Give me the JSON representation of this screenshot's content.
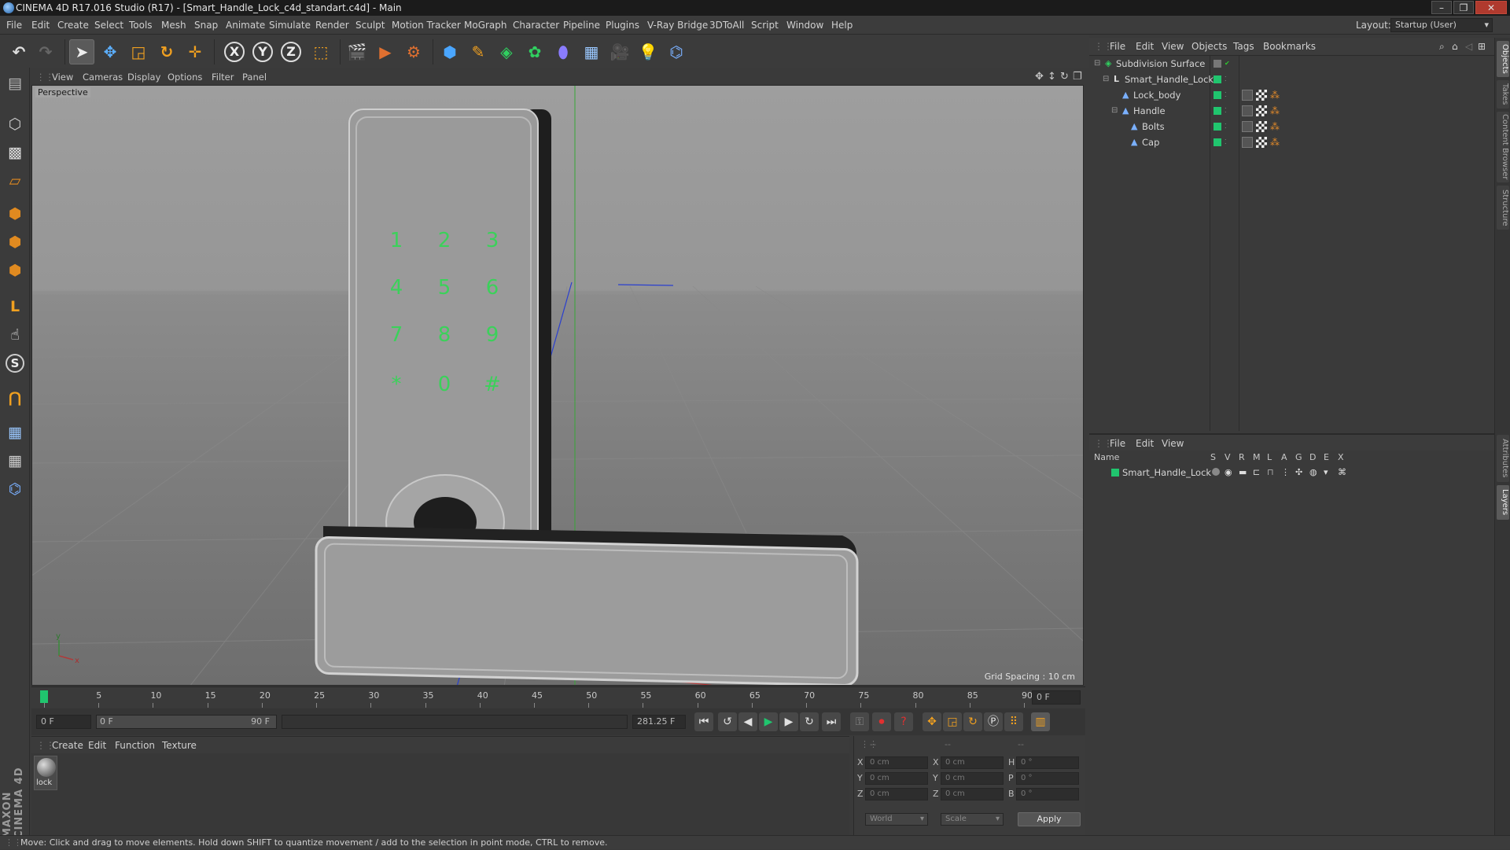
{
  "window": {
    "title": "CINEMA 4D R17.016 Studio (R17) - [Smart_Handle_Lock_c4d_standart.c4d] - Main",
    "controls": [
      "–",
      "❐",
      "✕"
    ]
  },
  "menu": [
    "File",
    "Edit",
    "Create",
    "Select",
    "Tools",
    "Mesh",
    "Snap",
    "Animate",
    "Simulate",
    "Render",
    "Sculpt",
    "Motion Tracker",
    "MoGraph",
    "Character",
    "Pipeline",
    "Plugins",
    "V-Ray Bridge",
    "3DToAll",
    "Script",
    "Window",
    "Help"
  ],
  "layout": {
    "label": "Layout:",
    "value": "Startup (User)"
  },
  "toolbar": {
    "axis_x": "X",
    "axis_y": "Y",
    "axis_z": "Z"
  },
  "viewport": {
    "menu": [
      "View",
      "Cameras",
      "Display",
      "Options",
      "Filter",
      "Panel"
    ],
    "label": "Perspective",
    "grid_spacing": "Grid Spacing : 10 cm",
    "keypad": [
      "1",
      "2",
      "3",
      "4",
      "5",
      "6",
      "7",
      "8",
      "9",
      "*",
      "0",
      "#"
    ],
    "axis_y": "y",
    "axis_x": "x"
  },
  "timeline": {
    "ticks": [
      "0",
      "5",
      "10",
      "15",
      "20",
      "25",
      "30",
      "35",
      "40",
      "45",
      "50",
      "55",
      "60",
      "65",
      "70",
      "75",
      "80",
      "85",
      "90"
    ],
    "current_frame": "0 F",
    "start_field": "0 F",
    "range_start": "0 F",
    "range_end": "90 F",
    "fps_field": "281.25 F",
    "end_field": "0 F",
    "playhead_fraction": 0
  },
  "material": {
    "menu": [
      "Create",
      "Edit",
      "Function",
      "Texture"
    ],
    "items": [
      {
        "name": "lock"
      }
    ]
  },
  "coordinates": {
    "header": [
      "--",
      "--",
      "--"
    ],
    "rows": [
      {
        "a": "X",
        "av": "0 cm",
        "b": "X",
        "bv": "0 cm",
        "c": "H",
        "cv": "0 °"
      },
      {
        "a": "Y",
        "av": "0 cm",
        "b": "Y",
        "bv": "0 cm",
        "c": "P",
        "cv": "0 °"
      },
      {
        "a": "Z",
        "av": "0 cm",
        "b": "Z",
        "bv": "0 cm",
        "c": "B",
        "cv": "0 °"
      }
    ],
    "mode": "World",
    "scale": "Scale",
    "apply": "Apply"
  },
  "objects": {
    "menu": [
      "File",
      "Edit",
      "View",
      "Objects",
      "Tags",
      "Bookmarks"
    ],
    "tree": [
      {
        "name": "Subdivision Surface",
        "depth": 0,
        "icon": "subdivision-icon"
      },
      {
        "name": "Smart_Handle_Lock",
        "depth": 1,
        "icon": "null-icon"
      },
      {
        "name": "Lock_body",
        "depth": 2,
        "icon": "polygon-icon"
      },
      {
        "name": "Handle",
        "depth": 2,
        "icon": "polygon-icon"
      },
      {
        "name": "Bolts",
        "depth": 3,
        "icon": "polygon-icon"
      },
      {
        "name": "Cap",
        "depth": 3,
        "icon": "polygon-icon"
      }
    ]
  },
  "layers": {
    "menu": [
      "File",
      "Edit",
      "View"
    ],
    "columns": [
      "Name",
      "S",
      "V",
      "R",
      "M",
      "L",
      "A",
      "G",
      "D",
      "E",
      "X"
    ],
    "rows": [
      {
        "name": "Smart_Handle_Lock"
      }
    ]
  },
  "side_tabs": [
    "Objects",
    "Takes",
    "Content Browser",
    "Structure",
    "Attributes",
    "Layers"
  ],
  "branding": "MAXON CINEMA 4D",
  "status": "Move: Click and drag to move elements. Hold down SHIFT to quantize movement / add to the selection in point mode, CTRL to remove.",
  "colors": {
    "accent_green": "#20c56e",
    "keypad_green": "#3bd15a",
    "orange": "#e0892a"
  }
}
